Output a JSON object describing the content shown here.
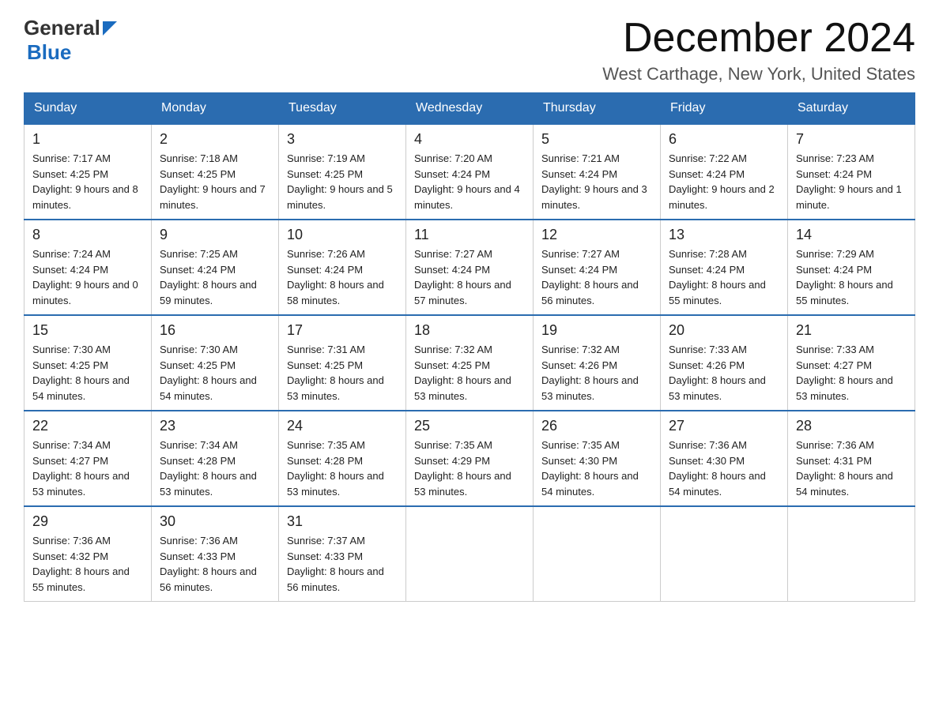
{
  "header": {
    "logo": {
      "general": "General",
      "blue": "Blue"
    },
    "title": "December 2024",
    "subtitle": "West Carthage, New York, United States"
  },
  "days_of_week": [
    "Sunday",
    "Monday",
    "Tuesday",
    "Wednesday",
    "Thursday",
    "Friday",
    "Saturday"
  ],
  "weeks": [
    [
      {
        "day": "1",
        "sunrise": "7:17 AM",
        "sunset": "4:25 PM",
        "daylight": "9 hours and 8 minutes."
      },
      {
        "day": "2",
        "sunrise": "7:18 AM",
        "sunset": "4:25 PM",
        "daylight": "9 hours and 7 minutes."
      },
      {
        "day": "3",
        "sunrise": "7:19 AM",
        "sunset": "4:25 PM",
        "daylight": "9 hours and 5 minutes."
      },
      {
        "day": "4",
        "sunrise": "7:20 AM",
        "sunset": "4:24 PM",
        "daylight": "9 hours and 4 minutes."
      },
      {
        "day": "5",
        "sunrise": "7:21 AM",
        "sunset": "4:24 PM",
        "daylight": "9 hours and 3 minutes."
      },
      {
        "day": "6",
        "sunrise": "7:22 AM",
        "sunset": "4:24 PM",
        "daylight": "9 hours and 2 minutes."
      },
      {
        "day": "7",
        "sunrise": "7:23 AM",
        "sunset": "4:24 PM",
        "daylight": "9 hours and 1 minute."
      }
    ],
    [
      {
        "day": "8",
        "sunrise": "7:24 AM",
        "sunset": "4:24 PM",
        "daylight": "9 hours and 0 minutes."
      },
      {
        "day": "9",
        "sunrise": "7:25 AM",
        "sunset": "4:24 PM",
        "daylight": "8 hours and 59 minutes."
      },
      {
        "day": "10",
        "sunrise": "7:26 AM",
        "sunset": "4:24 PM",
        "daylight": "8 hours and 58 minutes."
      },
      {
        "day": "11",
        "sunrise": "7:27 AM",
        "sunset": "4:24 PM",
        "daylight": "8 hours and 57 minutes."
      },
      {
        "day": "12",
        "sunrise": "7:27 AM",
        "sunset": "4:24 PM",
        "daylight": "8 hours and 56 minutes."
      },
      {
        "day": "13",
        "sunrise": "7:28 AM",
        "sunset": "4:24 PM",
        "daylight": "8 hours and 55 minutes."
      },
      {
        "day": "14",
        "sunrise": "7:29 AM",
        "sunset": "4:24 PM",
        "daylight": "8 hours and 55 minutes."
      }
    ],
    [
      {
        "day": "15",
        "sunrise": "7:30 AM",
        "sunset": "4:25 PM",
        "daylight": "8 hours and 54 minutes."
      },
      {
        "day": "16",
        "sunrise": "7:30 AM",
        "sunset": "4:25 PM",
        "daylight": "8 hours and 54 minutes."
      },
      {
        "day": "17",
        "sunrise": "7:31 AM",
        "sunset": "4:25 PM",
        "daylight": "8 hours and 53 minutes."
      },
      {
        "day": "18",
        "sunrise": "7:32 AM",
        "sunset": "4:25 PM",
        "daylight": "8 hours and 53 minutes."
      },
      {
        "day": "19",
        "sunrise": "7:32 AM",
        "sunset": "4:26 PM",
        "daylight": "8 hours and 53 minutes."
      },
      {
        "day": "20",
        "sunrise": "7:33 AM",
        "sunset": "4:26 PM",
        "daylight": "8 hours and 53 minutes."
      },
      {
        "day": "21",
        "sunrise": "7:33 AM",
        "sunset": "4:27 PM",
        "daylight": "8 hours and 53 minutes."
      }
    ],
    [
      {
        "day": "22",
        "sunrise": "7:34 AM",
        "sunset": "4:27 PM",
        "daylight": "8 hours and 53 minutes."
      },
      {
        "day": "23",
        "sunrise": "7:34 AM",
        "sunset": "4:28 PM",
        "daylight": "8 hours and 53 minutes."
      },
      {
        "day": "24",
        "sunrise": "7:35 AM",
        "sunset": "4:28 PM",
        "daylight": "8 hours and 53 minutes."
      },
      {
        "day": "25",
        "sunrise": "7:35 AM",
        "sunset": "4:29 PM",
        "daylight": "8 hours and 53 minutes."
      },
      {
        "day": "26",
        "sunrise": "7:35 AM",
        "sunset": "4:30 PM",
        "daylight": "8 hours and 54 minutes."
      },
      {
        "day": "27",
        "sunrise": "7:36 AM",
        "sunset": "4:30 PM",
        "daylight": "8 hours and 54 minutes."
      },
      {
        "day": "28",
        "sunrise": "7:36 AM",
        "sunset": "4:31 PM",
        "daylight": "8 hours and 54 minutes."
      }
    ],
    [
      {
        "day": "29",
        "sunrise": "7:36 AM",
        "sunset": "4:32 PM",
        "daylight": "8 hours and 55 minutes."
      },
      {
        "day": "30",
        "sunrise": "7:36 AM",
        "sunset": "4:33 PM",
        "daylight": "8 hours and 56 minutes."
      },
      {
        "day": "31",
        "sunrise": "7:37 AM",
        "sunset": "4:33 PM",
        "daylight": "8 hours and 56 minutes."
      },
      null,
      null,
      null,
      null
    ]
  ],
  "labels": {
    "sunrise": "Sunrise:",
    "sunset": "Sunset:",
    "daylight": "Daylight:"
  }
}
